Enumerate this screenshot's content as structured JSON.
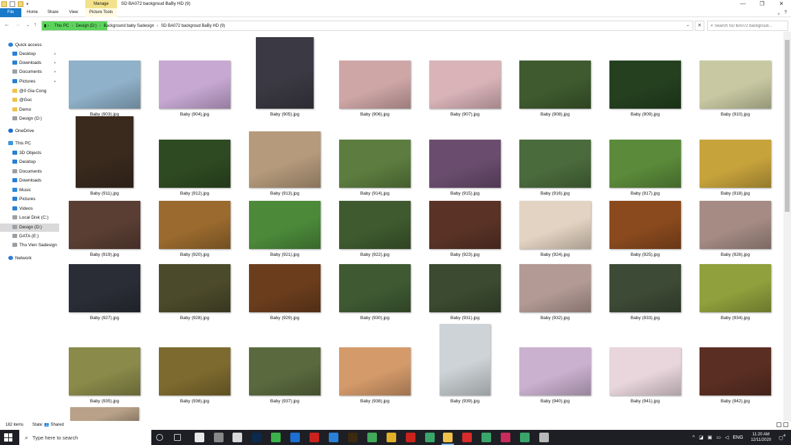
{
  "window": {
    "manage_tab": "Manage",
    "title": "SD BA072 backgroud BaBy HD (9)",
    "controls": [
      "—",
      "❐",
      "✕"
    ]
  },
  "ribbon": {
    "tabs": [
      "File",
      "Home",
      "Share",
      "View",
      "Picture Tools"
    ],
    "help": "?"
  },
  "address": {
    "crumbs": [
      "This PC",
      "Design (D:)",
      "Background baby Sadesign",
      "SD BA072 backgroud BaBy HD (9)"
    ],
    "search_placeholder": "Search SD BA072 backgroud..."
  },
  "sidebar": {
    "items": [
      {
        "label": "Quick access",
        "icon": "star-icon",
        "pinned": false
      },
      {
        "label": "Desktop",
        "icon": "desktop-icon",
        "pinned": true
      },
      {
        "label": "Downloads",
        "icon": "downloads-icon",
        "pinned": true
      },
      {
        "label": "Documents",
        "icon": "documents-icon",
        "pinned": true
      },
      {
        "label": "Pictures",
        "icon": "pictures-icon",
        "pinned": true
      },
      {
        "label": "@0 Gia Cong",
        "icon": "folder-icon",
        "pinned": false
      },
      {
        "label": "@Goc",
        "icon": "folder-icon",
        "pinned": false
      },
      {
        "label": "Demo",
        "icon": "folder-icon",
        "pinned": false
      },
      {
        "label": "Design (D:)",
        "icon": "drive-icon",
        "pinned": false
      },
      {
        "label": "OneDrive",
        "icon": "cloud-icon",
        "pinned": false
      },
      {
        "label": "This PC",
        "icon": "pc-icon",
        "pinned": false
      },
      {
        "label": "3D Objects",
        "icon": "cube-icon",
        "pinned": false
      },
      {
        "label": "Desktop",
        "icon": "desktop-icon",
        "pinned": false
      },
      {
        "label": "Documents",
        "icon": "documents-icon",
        "pinned": false
      },
      {
        "label": "Downloads",
        "icon": "downloads-icon",
        "pinned": false
      },
      {
        "label": "Music",
        "icon": "music-icon",
        "pinned": false
      },
      {
        "label": "Pictures",
        "icon": "pictures-icon",
        "pinned": false
      },
      {
        "label": "Videos",
        "icon": "videos-icon",
        "pinned": false
      },
      {
        "label": "Local Disk (C:)",
        "icon": "drive-icon",
        "pinned": false
      },
      {
        "label": "Design (D:)",
        "icon": "drive-icon",
        "pinned": false,
        "selected": true
      },
      {
        "label": "DATA  (E:)",
        "icon": "drive-icon",
        "pinned": false
      },
      {
        "label": "Thu Vien Sadesign",
        "icon": "drive-icon",
        "pinned": false
      },
      {
        "label": "Network",
        "icon": "network-icon",
        "pinned": false
      }
    ]
  },
  "files": [
    {
      "name": "Baby (903).jpg",
      "color": "#8fb1c9",
      "portrait": false
    },
    {
      "name": "Baby (904).jpg",
      "color": "#c7a8d3",
      "portrait": false
    },
    {
      "name": "Baby (905).jpg",
      "color": "#3b3a44",
      "portrait": true
    },
    {
      "name": "Baby (906).jpg",
      "color": "#cfa6a6",
      "portrait": false
    },
    {
      "name": "Baby (907).jpg",
      "color": "#d9b3b8",
      "portrait": false
    },
    {
      "name": "Baby (908).jpg",
      "color": "#3e5a2e",
      "portrait": false
    },
    {
      "name": "Baby (909).jpg",
      "color": "#24401f",
      "portrait": false
    },
    {
      "name": "Baby (910).jpg",
      "color": "#c8c9a2",
      "portrait": false
    },
    {
      "name": "Baby (911).jpg",
      "color": "#3a2a1e",
      "portrait": true
    },
    {
      "name": "Baby (912).jpg",
      "color": "#2e4a22",
      "portrait": false
    },
    {
      "name": "Baby (913).jpg",
      "color": "#b59a7b",
      "portrait": true
    },
    {
      "name": "Baby (914).jpg",
      "color": "#5c7d3f",
      "portrait": false
    },
    {
      "name": "Baby (915).jpg",
      "color": "#6a4d6e",
      "portrait": false
    },
    {
      "name": "Baby (916).jpg",
      "color": "#4a6b3c",
      "portrait": false
    },
    {
      "name": "Baby (917).jpg",
      "color": "#5b8a3a",
      "portrait": false
    },
    {
      "name": "Baby (918).jpg",
      "color": "#c7a33c",
      "portrait": false
    },
    {
      "name": "Baby (919).jpg",
      "color": "#5a3e33",
      "portrait": false
    },
    {
      "name": "Baby (920).jpg",
      "color": "#9a6a2e",
      "portrait": false
    },
    {
      "name": "Baby (921).jpg",
      "color": "#4c8a3a",
      "portrait": false
    },
    {
      "name": "Baby (922).jpg",
      "color": "#3f5a2f",
      "portrait": false
    },
    {
      "name": "Baby (923).jpg",
      "color": "#5a3326",
      "portrait": false
    },
    {
      "name": "Baby (924).jpg",
      "color": "#e3d3c2",
      "portrait": false
    },
    {
      "name": "Baby (925).jpg",
      "color": "#8a4a1e",
      "portrait": false
    },
    {
      "name": "Baby (926).jpg",
      "color": "#a58b84",
      "portrait": false
    },
    {
      "name": "Baby (927).jpg",
      "color": "#2a2d36",
      "portrait": false
    },
    {
      "name": "Baby (928).jpg",
      "color": "#4b4a2a",
      "portrait": false
    },
    {
      "name": "Baby (929).jpg",
      "color": "#6b3d1d",
      "portrait": false
    },
    {
      "name": "Baby (930).jpg",
      "color": "#3f5a33",
      "portrait": false
    },
    {
      "name": "Baby (931).jpg",
      "color": "#3b4a30",
      "portrait": false
    },
    {
      "name": "Baby (932).jpg",
      "color": "#b39a94",
      "portrait": false
    },
    {
      "name": "Baby (933).jpg",
      "color": "#3d4a35",
      "portrait": false
    },
    {
      "name": "Baby (934).jpg",
      "color": "#8fa03c",
      "portrait": false
    },
    {
      "name": "Baby (935).jpg",
      "color": "#8a8a4a",
      "portrait": false
    },
    {
      "name": "Baby (936).jpg",
      "color": "#7d6a2e",
      "portrait": false
    },
    {
      "name": "Baby (937).jpg",
      "color": "#5a6a3e",
      "portrait": false
    },
    {
      "name": "Baby (938).jpg",
      "color": "#d49a6a",
      "portrait": false
    },
    {
      "name": "Baby (939).jpg",
      "color": "#cdd3d6",
      "portrait": true
    },
    {
      "name": "Baby (940).jpg",
      "color": "#cab1cf",
      "portrait": false
    },
    {
      "name": "Baby (941).jpg",
      "color": "#e8d6dc",
      "portrait": false
    },
    {
      "name": "Baby (942).jpg",
      "color": "#5a2e22",
      "portrait": false
    },
    {
      "name": "",
      "color": "#b8a188",
      "portrait": false
    }
  ],
  "status": {
    "items": "182 items",
    "state": "State: 👥 Shared"
  },
  "taskbar": {
    "search_placeholder": "Type here to search",
    "apps": [
      {
        "icon": "cortana-icon",
        "color": "#1d1f24"
      },
      {
        "icon": "task-view-icon",
        "color": "#1d1f24"
      },
      {
        "icon": "app-1-icon",
        "color": "#e8e8e8"
      },
      {
        "icon": "app-2-icon",
        "color": "#888"
      },
      {
        "icon": "app-3-icon",
        "color": "#d8d8d8"
      },
      {
        "icon": "photoshop-icon",
        "color": "#0b2a4d"
      },
      {
        "icon": "camtasia-icon",
        "color": "#3bb34a"
      },
      {
        "icon": "teamviewer-icon",
        "color": "#1e6fd1"
      },
      {
        "icon": "filezilla-icon",
        "color": "#c9231c"
      },
      {
        "icon": "app-4-icon",
        "color": "#2a7fd6"
      },
      {
        "icon": "bridge-icon",
        "color": "#3b2a10"
      },
      {
        "icon": "app-5-icon",
        "color": "#42a85a"
      },
      {
        "icon": "chrome-icon",
        "color": "#e0b02a"
      },
      {
        "icon": "app-6-icon",
        "color": "#c9231c"
      },
      {
        "icon": "app-7-icon",
        "color": "#3aa56b"
      },
      {
        "icon": "file-explorer-icon",
        "color": "#f0c24b",
        "active": true
      },
      {
        "icon": "app-8-icon",
        "color": "#d92b2b"
      },
      {
        "icon": "chrome-2-icon",
        "color": "#3aa56b"
      },
      {
        "icon": "app-9-icon",
        "color": "#c92b5b"
      },
      {
        "icon": "chrome-3-icon",
        "color": "#3aa56b"
      },
      {
        "icon": "app-10-icon",
        "color": "#b8b8b8"
      }
    ],
    "lang": "ENG",
    "time": "11:20 AM",
    "date": "12/11/2020",
    "notifications": "4"
  }
}
